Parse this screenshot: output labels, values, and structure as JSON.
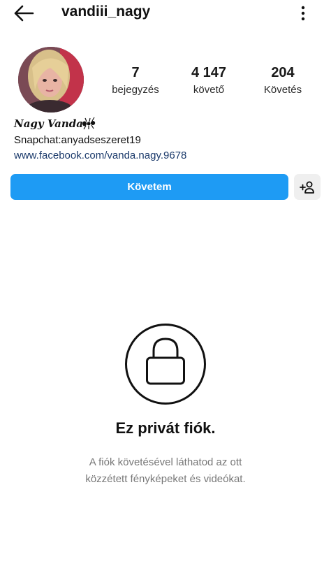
{
  "header": {
    "username": "vandiii_nagy",
    "back_icon": "arrow-left-icon",
    "more_icon": "more-vertical-icon"
  },
  "profile": {
    "avatar_icon": "profile-avatar",
    "stats": {
      "posts": {
        "value": "7",
        "label": "bejegyzés"
      },
      "followers": {
        "value": "4 147",
        "label": "követő"
      },
      "following": {
        "value": "204",
        "label": "Követés"
      }
    },
    "full_name": "Nagy Vanda",
    "name_emoji_icon": "ant-icon",
    "bio": "Snapchat:anyadseszeret19",
    "link": "www.facebook.com/vanda.nagy.9678"
  },
  "actions": {
    "follow_label": "Követem",
    "follow_color": "#1e9bf4",
    "suggest_icon": "add-person-icon"
  },
  "private_notice": {
    "icon": "lock-icon",
    "title": "Ez privát fiók.",
    "line1": "A fiók követésével láthatod az ott",
    "line2": "közzétett fényképeket és videókat."
  }
}
